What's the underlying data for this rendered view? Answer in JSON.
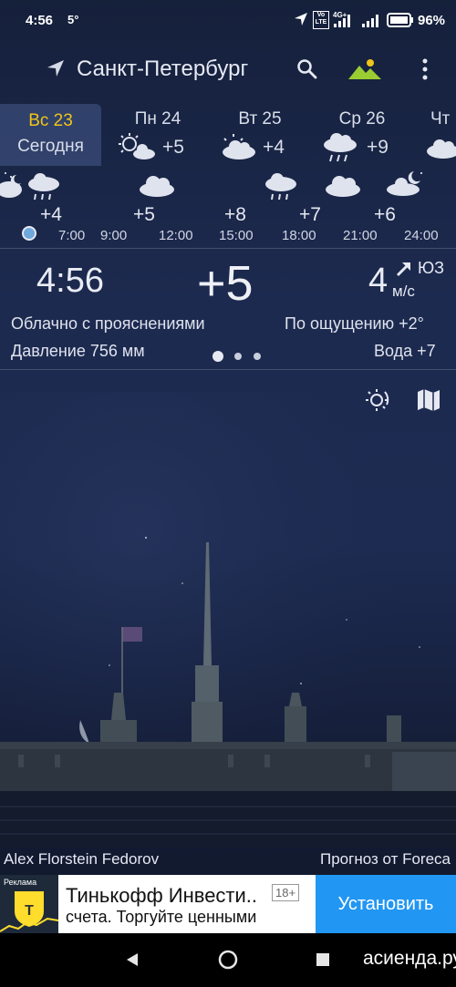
{
  "status": {
    "time": "4:56",
    "temp": "5°",
    "battery": "96%",
    "volte": "Vo LTE",
    "net": "4G+"
  },
  "header": {
    "city": "Санкт-Петербург"
  },
  "days": [
    {
      "day": "Вс 23",
      "sub": "Сегодня",
      "temp": ""
    },
    {
      "day": "Пн 24",
      "sub": "",
      "temp": "+5"
    },
    {
      "day": "Вт 25",
      "sub": "",
      "temp": "+4"
    },
    {
      "day": "Ср 26",
      "sub": "",
      "temp": "+9"
    },
    {
      "day": "Чт",
      "sub": "",
      "temp": ""
    }
  ],
  "hourly": {
    "temps": [
      "+4",
      "+5",
      "+8",
      "+7",
      "+6"
    ],
    "times": [
      "7:00",
      "9:00",
      "12:00",
      "15:00",
      "18:00",
      "21:00",
      "24:00"
    ]
  },
  "current": {
    "time": "4:56",
    "temp": "+5",
    "wind_speed": "4",
    "wind_unit": "м/с",
    "wind_dir": "ЮЗ",
    "condition": "Облачно с прояснениями",
    "feels": "По ощущению +2°",
    "pressure": "Давление 756 мм",
    "water": "Вода +7"
  },
  "footer": {
    "author": "Alex Florstein Fedorov",
    "source": "Прогноз от Foreca"
  },
  "ad": {
    "badge": "Реклама",
    "title": "Тинькофф Инвести..",
    "age": "18+",
    "subtitle": "счета. Торгуйте ценными",
    "button": "Установить"
  },
  "watermark": "асиенда.ру",
  "colors": {
    "ad_button": "#2196f3",
    "accent_green": "#9acd32",
    "now_dot": "#6fa8dc"
  }
}
